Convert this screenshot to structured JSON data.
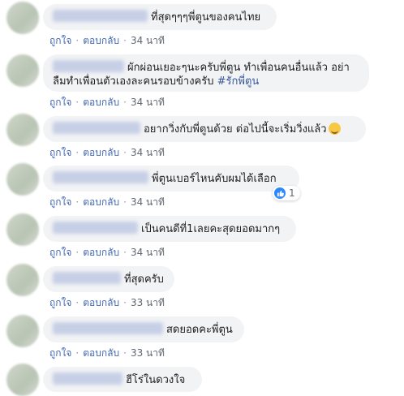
{
  "actions": {
    "like": "ถูกใจ",
    "reply": "ตอบกลับ",
    "separator": "·"
  },
  "comments": [
    {
      "text": "ที่สุดๆๆๆพี่ตูนของคนไทย",
      "time": "34 นาที"
    },
    {
      "text": "ผักผ่อนเยอะๆนะครับพี่ตูน ทำเพื่อนคนอื่นแล้ว อย่า",
      "text2": "ลืมทำเพื่อนตัวเองละคนรอบข้างครับ ",
      "hashtag": "#รักพี่ตูน",
      "time": "34 นาที"
    },
    {
      "text": "อยากวิ่งกับพี่ตูนด้วย ต่อไปนี้จะเริ่มวิ่งแล้ว",
      "emoji": "grinning-emoji",
      "time": "34 นาที"
    },
    {
      "text": "พี่ตูนเบอร์ไหนคับผมได้เลือก",
      "time": "34 นาที",
      "reaction_count": "1"
    },
    {
      "text": "เป็นคนดีที่1เลยคะสุดยอดมากๆ",
      "time": "34 นาที"
    },
    {
      "text": "ที่สุดครับ",
      "time": "33 นาที"
    },
    {
      "text": "สดยอดคะพี่ตูน",
      "time": "33 นาที"
    },
    {
      "text": "ฮีโร่ในดวงใจ"
    }
  ]
}
